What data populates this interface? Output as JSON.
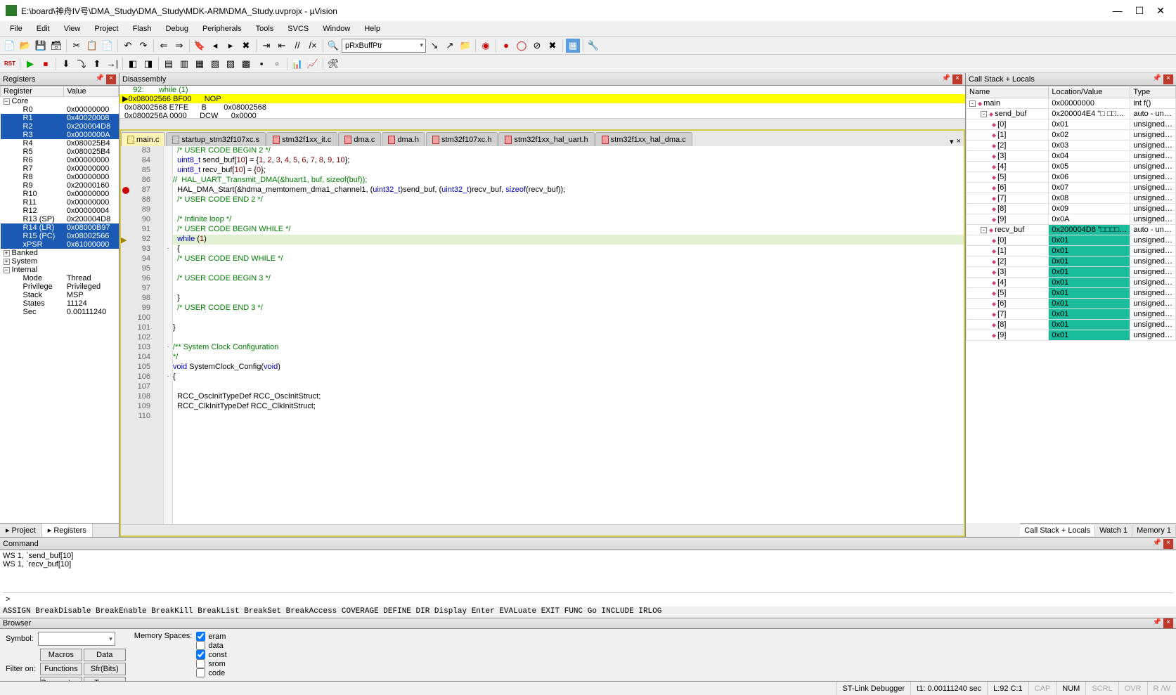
{
  "window": {
    "title": "E:\\board\\神舟IV号\\DMA_Study\\DMA_Study\\MDK-ARM\\DMA_Study.uvprojx - µVision"
  },
  "menu": [
    "File",
    "Edit",
    "View",
    "Project",
    "Flash",
    "Debug",
    "Peripherals",
    "Tools",
    "SVCS",
    "Window",
    "Help"
  ],
  "toolbar1_combo": "pRxBuffPtr",
  "toolbar2_rst": "RST",
  "panels": {
    "registers": "Registers",
    "disassembly": "Disassembly",
    "callstack": "Call Stack + Locals",
    "command": "Command",
    "browser": "Browser"
  },
  "registers": {
    "headers": [
      "Register",
      "Value"
    ],
    "groups": [
      {
        "name": "Core",
        "expanded": true,
        "rows": [
          {
            "r": "R0",
            "v": "0x00000000"
          },
          {
            "r": "R1",
            "v": "0x40020008",
            "sel": true
          },
          {
            "r": "R2",
            "v": "0x200004D8",
            "sel": true
          },
          {
            "r": "R3",
            "v": "0x0000000A",
            "sel": true
          },
          {
            "r": "R4",
            "v": "0x080025B4"
          },
          {
            "r": "R5",
            "v": "0x080025B4"
          },
          {
            "r": "R6",
            "v": "0x00000000"
          },
          {
            "r": "R7",
            "v": "0x00000000"
          },
          {
            "r": "R8",
            "v": "0x00000000"
          },
          {
            "r": "R9",
            "v": "0x20000160"
          },
          {
            "r": "R10",
            "v": "0x00000000"
          },
          {
            "r": "R11",
            "v": "0x00000000"
          },
          {
            "r": "R12",
            "v": "0x00000004"
          },
          {
            "r": "R13 (SP)",
            "v": "0x200004D8"
          },
          {
            "r": "R14 (LR)",
            "v": "0x08000B97",
            "sel": true
          },
          {
            "r": "R15 (PC)",
            "v": "0x08002566",
            "sel": true
          },
          {
            "r": "xPSR",
            "v": "0x61000000",
            "sel": true
          }
        ]
      },
      {
        "name": "Banked",
        "expanded": false
      },
      {
        "name": "System",
        "expanded": false
      },
      {
        "name": "Internal",
        "expanded": true,
        "rows": [
          {
            "r": "Mode",
            "v": "Thread"
          },
          {
            "r": "Privilege",
            "v": "Privileged"
          },
          {
            "r": "Stack",
            "v": "MSP"
          },
          {
            "r": "States",
            "v": "11124"
          },
          {
            "r": "Sec",
            "v": "0.00111240"
          }
        ]
      }
    ]
  },
  "left_tabs": [
    {
      "label": "Project",
      "icon": "project-icon"
    },
    {
      "label": "Registers",
      "icon": "registers-icon",
      "active": true
    }
  ],
  "disassembly": {
    "lines": [
      {
        "text": "    92:       while (1)",
        "green": true
      },
      {
        "text": "0x08002566 BF00      NOP",
        "cur": true,
        "arrow": true
      },
      {
        "text": "0x08002568 E7FE      B        0x08002568"
      },
      {
        "text": "0x0800256A 0000      DCW      0x0000"
      }
    ]
  },
  "editor_tabs": [
    {
      "label": "main.c",
      "active": true,
      "cls": "yellow"
    },
    {
      "label": "startup_stm32f107xc.s",
      "cls": "grey"
    },
    {
      "label": "stm32f1xx_it.c",
      "cls": "red"
    },
    {
      "label": "dma.c",
      "cls": "red"
    },
    {
      "label": "dma.h",
      "cls": "red"
    },
    {
      "label": "stm32f107xc.h",
      "cls": "red"
    },
    {
      "label": "stm32f1xx_hal_uart.h",
      "cls": "red"
    },
    {
      "label": "stm32f1xx_hal_dma.c",
      "cls": "red"
    }
  ],
  "code_lines": [
    {
      "n": 83,
      "t": "  /* USER CODE BEGIN 2 */",
      "cm": true
    },
    {
      "n": 84,
      "t": "  uint8_t send_buf[10] = {1, 2, 3, 4, 5, 6, 7, 8, 9, 10};"
    },
    {
      "n": 85,
      "t": "  uint8_t recv_buf[10] = {0};"
    },
    {
      "n": 86,
      "t": "//  HAL_UART_Transmit_DMA(&huart1, buf, sizeof(buf));",
      "cm": true
    },
    {
      "n": 87,
      "t": "  HAL_DMA_Start(&hdma_memtomem_dma1_channel1, (uint32_t)send_buf, (uint32_t)recv_buf, sizeof(recv_buf));",
      "bp": true
    },
    {
      "n": 88,
      "t": "  /* USER CODE END 2 */",
      "cm": true
    },
    {
      "n": 89,
      "t": ""
    },
    {
      "n": 90,
      "t": "  /* Infinite loop */",
      "cm": true
    },
    {
      "n": 91,
      "t": "  /* USER CODE BEGIN WHILE */",
      "cm": true
    },
    {
      "n": 92,
      "t": "  while (1)",
      "cur": true,
      "arrow": true
    },
    {
      "n": 93,
      "t": "  {",
      "fold": "-"
    },
    {
      "n": 94,
      "t": "  /* USER CODE END WHILE */",
      "cm": true
    },
    {
      "n": 95,
      "t": ""
    },
    {
      "n": 96,
      "t": "  /* USER CODE BEGIN 3 */",
      "cm": true
    },
    {
      "n": 97,
      "t": ""
    },
    {
      "n": 98,
      "t": "  }"
    },
    {
      "n": 99,
      "t": "  /* USER CODE END 3 */",
      "cm": true
    },
    {
      "n": 100,
      "t": ""
    },
    {
      "n": 101,
      "t": "}"
    },
    {
      "n": 102,
      "t": ""
    },
    {
      "n": 103,
      "t": "/** System Clock Configuration",
      "cm": true,
      "fold": "-"
    },
    {
      "n": 104,
      "t": "*/",
      "cm": true
    },
    {
      "n": 105,
      "t": "void SystemClock_Config(void)"
    },
    {
      "n": 106,
      "t": "{",
      "fold": "-"
    },
    {
      "n": 107,
      "t": ""
    },
    {
      "n": 108,
      "t": "  RCC_OscInitTypeDef RCC_OscInitStruct;"
    },
    {
      "n": 109,
      "t": "  RCC_ClkInitTypeDef RCC_ClkInitStruct;"
    },
    {
      "n": 110,
      "t": ""
    }
  ],
  "locals": {
    "headers": [
      "Name",
      "Location/Value",
      "Type"
    ],
    "tree": [
      {
        "name": "main",
        "loc": "0x00000000",
        "type": "int f()",
        "lvl": 0,
        "pm": "-",
        "ic": "fn"
      },
      {
        "name": "send_buf",
        "loc": "0x200004E4 \"□ □□…",
        "type": "auto - un…",
        "lvl": 1,
        "pm": "-",
        "ic": "var"
      },
      {
        "name": "[0]",
        "loc": "0x01",
        "type": "unsigned…",
        "lvl": 2,
        "ic": "el"
      },
      {
        "name": "[1]",
        "loc": "0x02",
        "type": "unsigned…",
        "lvl": 2,
        "ic": "el"
      },
      {
        "name": "[2]",
        "loc": "0x03",
        "type": "unsigned…",
        "lvl": 2,
        "ic": "el"
      },
      {
        "name": "[3]",
        "loc": "0x04",
        "type": "unsigned…",
        "lvl": 2,
        "ic": "el"
      },
      {
        "name": "[4]",
        "loc": "0x05",
        "type": "unsigned…",
        "lvl": 2,
        "ic": "el"
      },
      {
        "name": "[5]",
        "loc": "0x06",
        "type": "unsigned…",
        "lvl": 2,
        "ic": "el"
      },
      {
        "name": "[6]",
        "loc": "0x07",
        "type": "unsigned…",
        "lvl": 2,
        "ic": "el"
      },
      {
        "name": "[7]",
        "loc": "0x08",
        "type": "unsigned…",
        "lvl": 2,
        "ic": "el"
      },
      {
        "name": "[8]",
        "loc": "0x09",
        "type": "unsigned…",
        "lvl": 2,
        "ic": "el"
      },
      {
        "name": "[9]",
        "loc": "0x0A",
        "type": "unsigned…",
        "lvl": 2,
        "ic": "el"
      },
      {
        "name": "recv_buf",
        "loc": "0x200004D8 \"□□□□…",
        "type": "auto - un…",
        "lvl": 1,
        "pm": "-",
        "ic": "var",
        "hl": true
      },
      {
        "name": "[0]",
        "loc": "0x01",
        "type": "unsigned…",
        "lvl": 2,
        "ic": "el",
        "hl": true
      },
      {
        "name": "[1]",
        "loc": "0x01",
        "type": "unsigned…",
        "lvl": 2,
        "ic": "el",
        "hl": true
      },
      {
        "name": "[2]",
        "loc": "0x01",
        "type": "unsigned…",
        "lvl": 2,
        "ic": "el",
        "hl": true
      },
      {
        "name": "[3]",
        "loc": "0x01",
        "type": "unsigned…",
        "lvl": 2,
        "ic": "el",
        "hl": true
      },
      {
        "name": "[4]",
        "loc": "0x01",
        "type": "unsigned…",
        "lvl": 2,
        "ic": "el",
        "hl": true
      },
      {
        "name": "[5]",
        "loc": "0x01",
        "type": "unsigned…",
        "lvl": 2,
        "ic": "el",
        "hl": true
      },
      {
        "name": "[6]",
        "loc": "0x01",
        "type": "unsigned…",
        "lvl": 2,
        "ic": "el",
        "hl": true
      },
      {
        "name": "[7]",
        "loc": "0x01",
        "type": "unsigned…",
        "lvl": 2,
        "ic": "el",
        "hl": true
      },
      {
        "name": "[8]",
        "loc": "0x01",
        "type": "unsigned…",
        "lvl": 2,
        "ic": "el",
        "hl": true
      },
      {
        "name": "[9]",
        "loc": "0x01",
        "type": "unsigned…",
        "lvl": 2,
        "ic": "el",
        "hl": true
      }
    ]
  },
  "right_tabs": [
    {
      "label": "Call Stack + Locals",
      "active": true
    },
    {
      "label": "Watch 1"
    },
    {
      "label": "Memory 1"
    }
  ],
  "command": {
    "output": "WS 1, `send_buf[10]\nWS 1, `recv_buf[10]",
    "prompt": ">",
    "help": "ASSIGN BreakDisable BreakEnable BreakKill BreakList BreakSet BreakAccess COVERAGE DEFINE DIR Display Enter EVALuate EXIT FUNC Go INCLUDE IRLOG"
  },
  "browser": {
    "symbol_label": "Symbol:",
    "filter_label": "Filter on:",
    "memspaces_label": "Memory Spaces:",
    "buttons": [
      "Macros",
      "Data",
      "Functions",
      "Sfr(Bits)",
      "Parameters",
      "Types"
    ],
    "checks": [
      {
        "label": "eram",
        "checked": true
      },
      {
        "label": "data",
        "checked": false
      },
      {
        "label": "const",
        "checked": true
      },
      {
        "label": "srom",
        "checked": false
      },
      {
        "label": "code",
        "checked": false
      }
    ]
  },
  "status": {
    "debugger": "ST-Link Debugger",
    "time": "t1: 0.00111240 sec",
    "pos": "L:92 C:1",
    "caps": "CAP",
    "num": "NUM",
    "scrl": "SCRL",
    "ovr": "OVR",
    "rw": "R /W"
  }
}
